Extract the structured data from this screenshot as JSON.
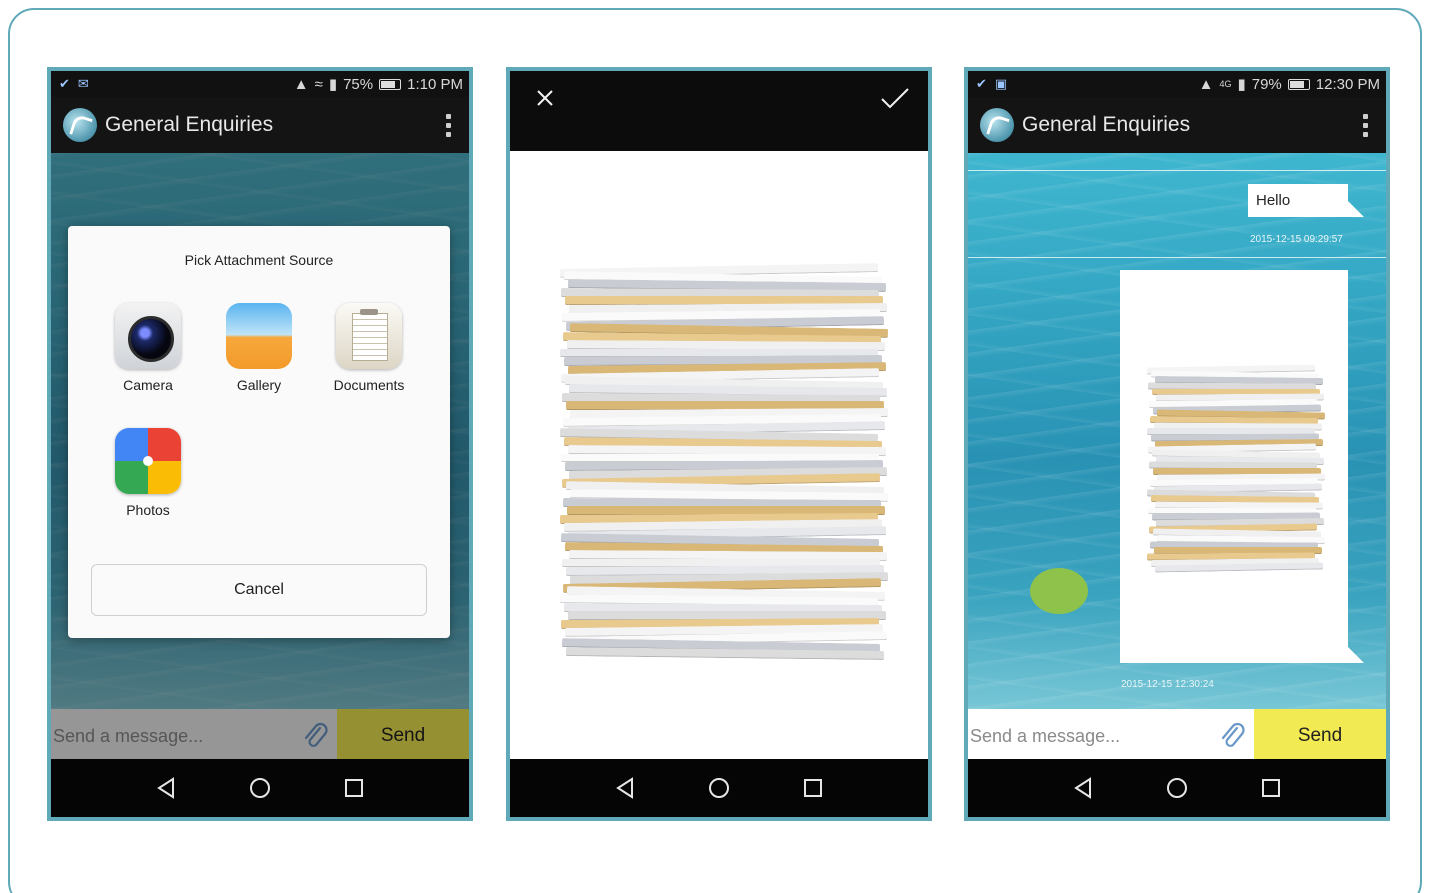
{
  "phones": [
    {
      "status": {
        "battery": "75%",
        "time": "1:10 PM"
      },
      "app_title": "General Enquiries",
      "dialog": {
        "title": "Pick Attachment Source",
        "sources": [
          {
            "label": "Camera",
            "icon": "camera-icon"
          },
          {
            "label": "Gallery",
            "icon": "gallery-icon"
          },
          {
            "label": "Documents",
            "icon": "documents-icon"
          },
          {
            "label": "Photos",
            "icon": "photos-icon"
          }
        ],
        "cancel_label": "Cancel"
      },
      "input": {
        "placeholder": "Send a message...",
        "send_label": "Send"
      }
    },
    {
      "toolbar": {
        "close_icon": "close-icon",
        "confirm_icon": "check-icon"
      }
    },
    {
      "status": {
        "battery": "79%",
        "time": "12:30 PM",
        "network": "4G"
      },
      "app_title": "General Enquiries",
      "messages": [
        {
          "text": "Hello",
          "timestamp": "2015-12-15 09:29:57"
        },
        {
          "type": "image",
          "timestamp": "2015-12-15 12:30:24"
        }
      ],
      "input": {
        "placeholder": "Send a message...",
        "send_label": "Send"
      }
    }
  ],
  "colors": {
    "frame": "#5fa9b8",
    "send_button": "#f1ea52",
    "ocean": "#34a7c4"
  }
}
